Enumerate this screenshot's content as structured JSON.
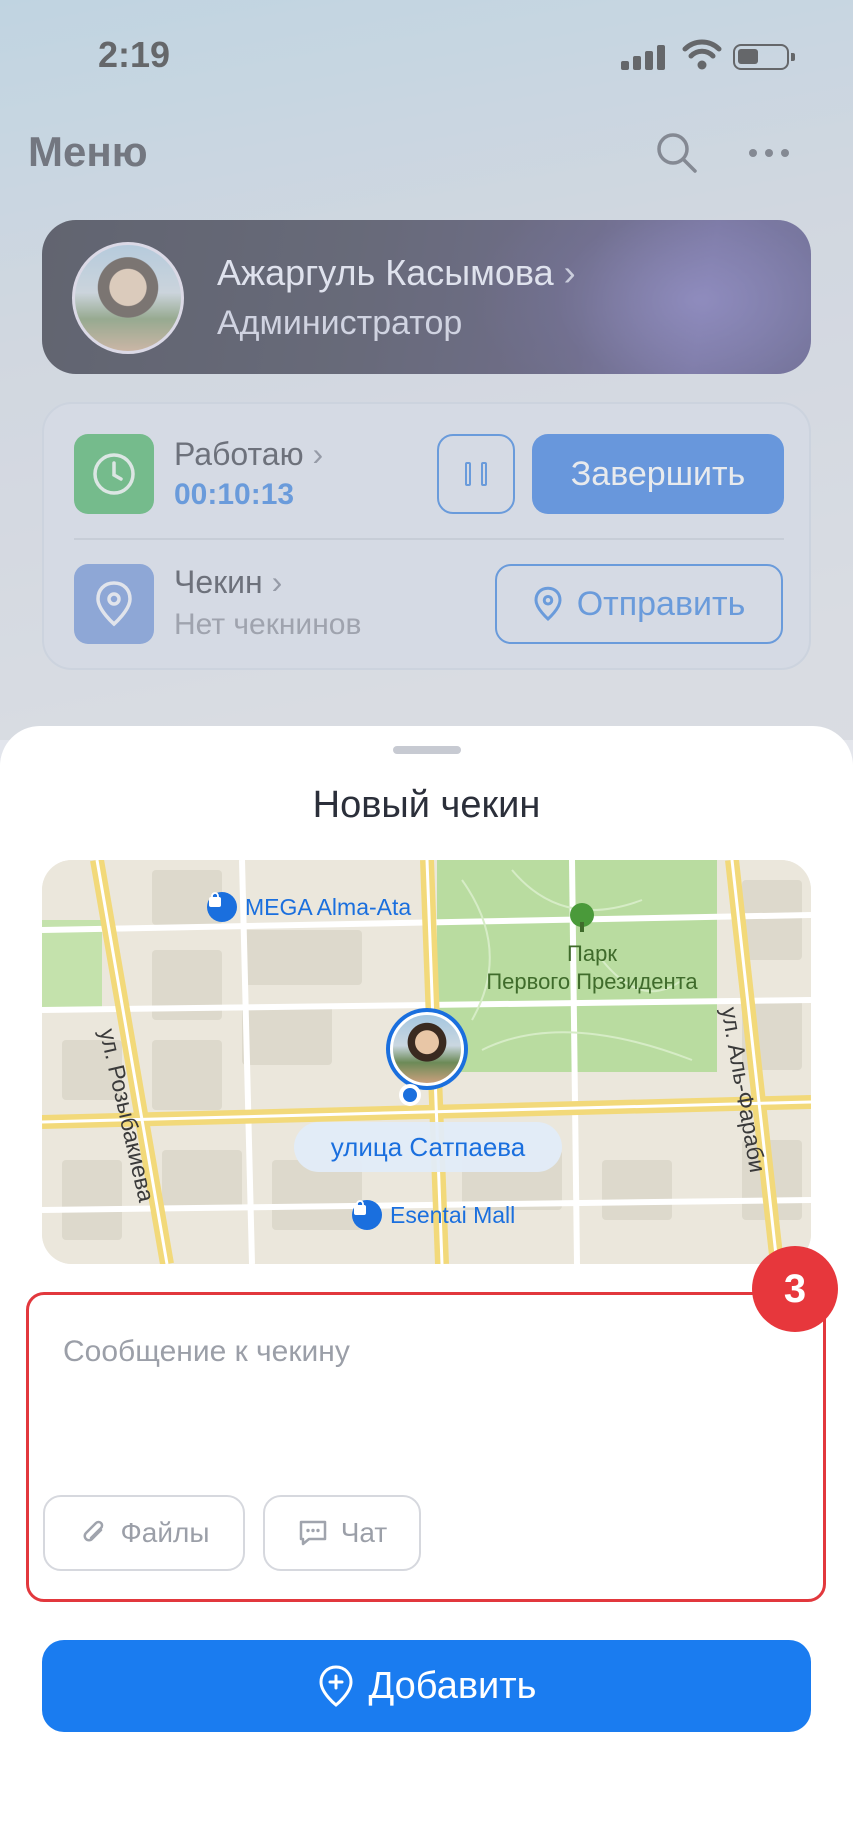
{
  "status_bar": {
    "time": "2:19",
    "signal_icon": "cellular-signal-icon",
    "wifi_icon": "wifi-icon",
    "battery_icon": "battery-icon"
  },
  "header": {
    "title": "Меню",
    "search_icon": "search-icon",
    "more_icon": "more-dots-icon"
  },
  "profile": {
    "name": "Ажаргуль Касымова",
    "chevron": "›",
    "role": "Администратор"
  },
  "work": {
    "label": "Работаю",
    "chevron": "›",
    "timer": "00:10:13",
    "pause_icon": "pause-icon",
    "finish_label": "Завершить",
    "accent": "#1a6fde",
    "tile_color": "#2faa4f"
  },
  "checkin": {
    "label": "Чекин",
    "chevron": "›",
    "status": "Нет чекнинов",
    "send_label": "Отправить",
    "tile_color": "#5b86d6"
  },
  "sheet": {
    "title": "Новый чекин",
    "map": {
      "poi_top": "MEGA Alma-Ata",
      "park_line1": "Парк",
      "park_line2": "Первого Президента",
      "street_left": "ул. Розыбакиева",
      "street_right": "ул. Аль-Фараби",
      "street_current": "улица Сатпаева",
      "poi_bottom": "Esentai Mall"
    },
    "message_placeholder": "Сообщение к чекину",
    "files_label": "Файлы",
    "chat_label": "Чат",
    "badge": "3",
    "add_label": "Добавить"
  }
}
